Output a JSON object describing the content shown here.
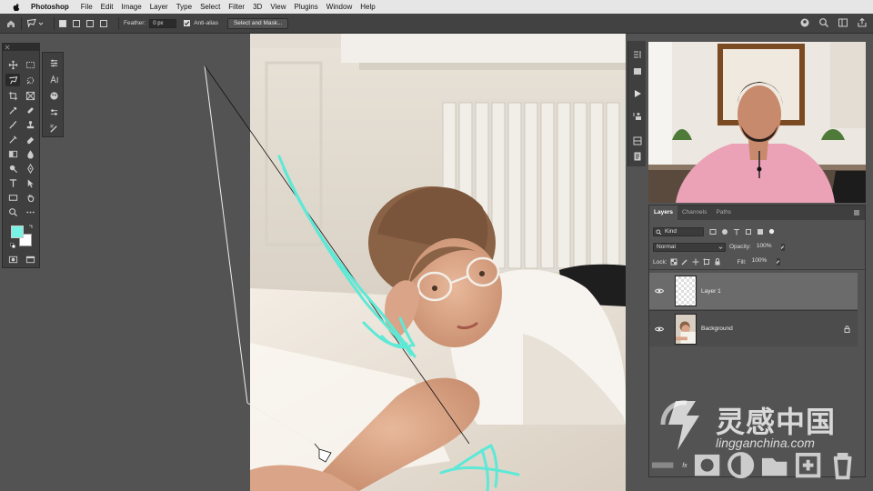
{
  "menu": {
    "app": "Photoshop",
    "items": [
      "File",
      "Edit",
      "Image",
      "Layer",
      "Type",
      "Select",
      "Filter",
      "3D",
      "View",
      "Plugins",
      "Window",
      "Help"
    ]
  },
  "options": {
    "feather_label": "Feather:",
    "feather_value": "0 px",
    "antialias_label": "Anti-alias",
    "antialias_checked": true,
    "select_mask_label": "Select and Mask..."
  },
  "layers_panel": {
    "tabs": [
      "Layers",
      "Channels",
      "Paths"
    ],
    "filter_kind": "Kind",
    "blend_mode": "Normal",
    "opacity_label": "Opacity:",
    "opacity_value": "100%",
    "lock_label": "Lock:",
    "fill_label": "Fill:",
    "fill_value": "100%",
    "layers": [
      {
        "name": "Layer 1",
        "selected": true,
        "visible": true,
        "locked": false
      },
      {
        "name": "Background",
        "selected": false,
        "visible": true,
        "locked": true
      }
    ],
    "footer_fx": "fx"
  },
  "swatches": {
    "foreground": "#77f2e4",
    "background": "#ffffff"
  },
  "accent_stroke": "#5ee8d6",
  "watermark": {
    "chinese": "灵感中国",
    "domain": "lingganchina.com"
  }
}
